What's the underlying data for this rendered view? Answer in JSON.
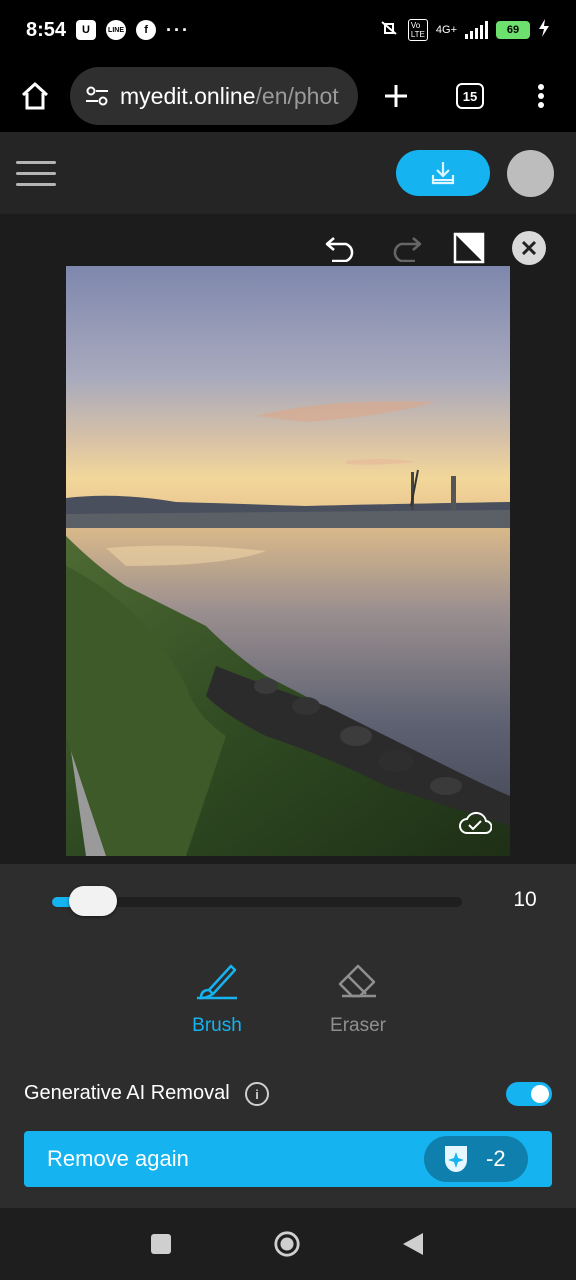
{
  "status_bar": {
    "time": "8:54",
    "notif_icons": [
      "u-icon",
      "line-icon",
      "facebook-icon"
    ],
    "more_dots": "···",
    "network": "4G+",
    "battery": "69"
  },
  "browser": {
    "url_host": "myedit.online",
    "url_path": "/en/phot",
    "tab_count": "15"
  },
  "colors": {
    "accent": "#15b3ef",
    "panel": "#2d2d2d",
    "editor_bg": "#1c1c1c"
  },
  "editor": {
    "brush_size": "10",
    "brush_size_fraction": 0.1,
    "tools": {
      "brush": "Brush",
      "eraser": "Eraser"
    },
    "gen_ai_label": "Generative AI Removal",
    "gen_ai_enabled": true,
    "remove_button": "Remove again",
    "credit_cost": "-2"
  }
}
